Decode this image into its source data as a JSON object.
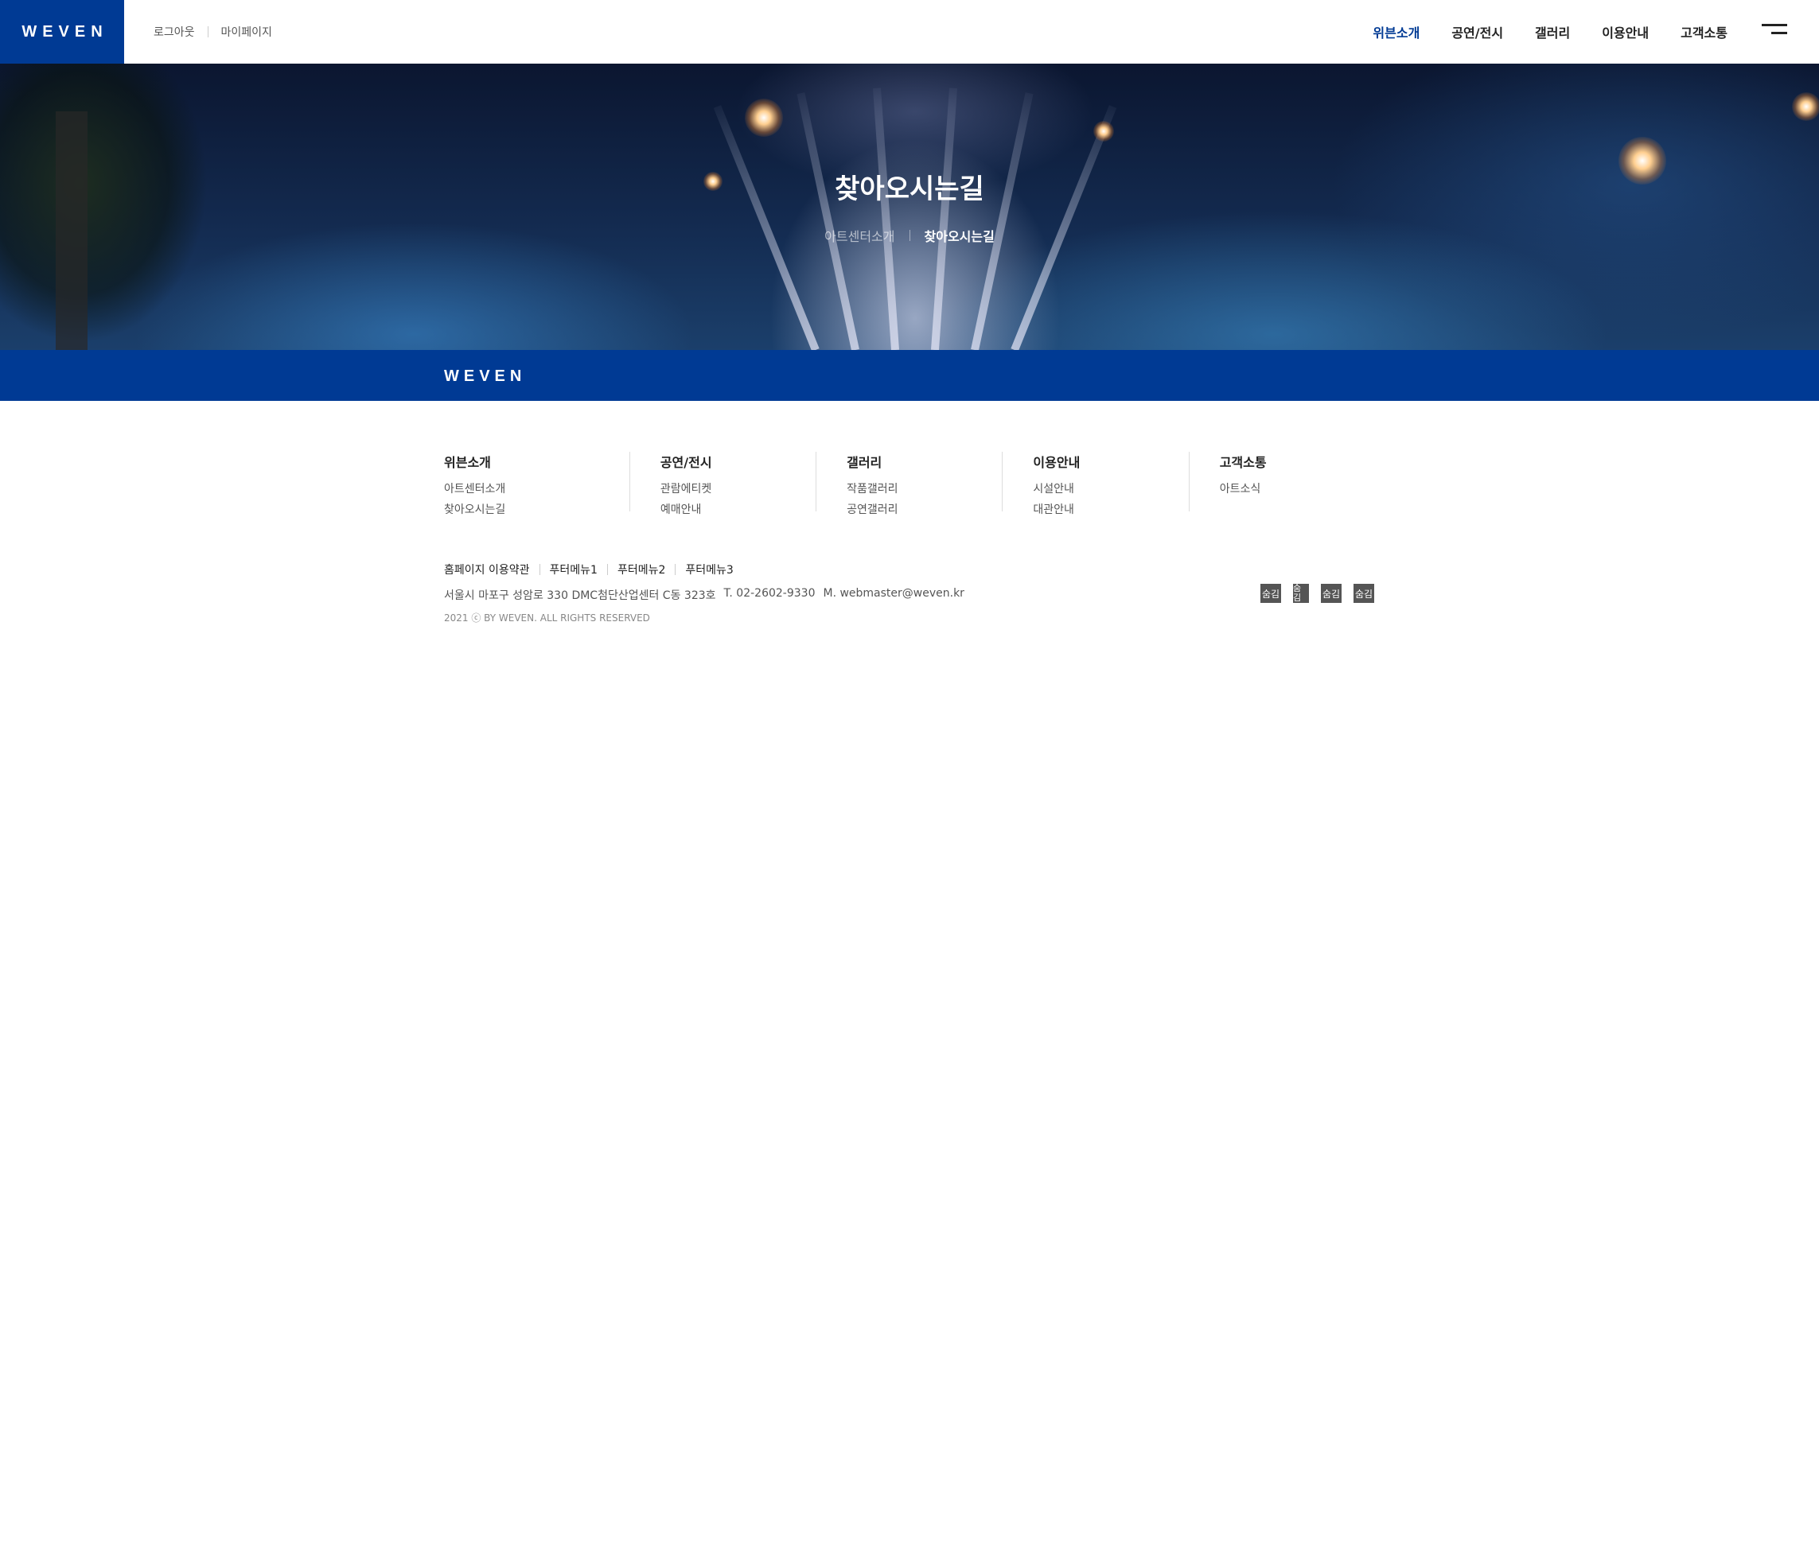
{
  "header": {
    "logo": "WEVEN",
    "util_links": [
      "로그아웃",
      "마이페이지"
    ],
    "nav": [
      {
        "label": "위븐소개",
        "active": true
      },
      {
        "label": "공연/전시",
        "active": false
      },
      {
        "label": "갤러리",
        "active": false
      },
      {
        "label": "이용안내",
        "active": false
      },
      {
        "label": "고객소통",
        "active": false
      }
    ],
    "menu_icon": "hamburger-menu-icon"
  },
  "hero": {
    "title": "찾아오시는길",
    "breadcrumb": [
      "아트센터소개",
      "찾아오시는길"
    ]
  },
  "band": {
    "logo": "WEVEN"
  },
  "sitemap": [
    {
      "title": "위븐소개",
      "items": [
        "아트센터소개",
        "찾아오시는길"
      ]
    },
    {
      "title": "공연/전시",
      "items": [
        "관람에티켓",
        "예매안내"
      ]
    },
    {
      "title": "갤러리",
      "items": [
        "작품갤러리",
        "공연갤러리"
      ]
    },
    {
      "title": "이용안내",
      "items": [
        "시설안내",
        "대관안내"
      ]
    },
    {
      "title": "고객소통",
      "items": [
        "아트소식"
      ]
    }
  ],
  "footer": {
    "links": [
      "홈페이지 이용약관",
      "푸터메뉴1",
      "푸터메뉴2",
      "푸터메뉴3"
    ],
    "address": "서울시 마포구 성암로 330 DMC첨단산업센터 C동 323호",
    "tel": "T. 02-2602-9330",
    "mail": "M. webmaster@weven.kr",
    "copyright": "2021 ⓒ BY WEVEN. ALL RIGHTS RESERVED",
    "icons": [
      "숨김",
      "숨김",
      "숨김",
      "숨김"
    ]
  },
  "colors": {
    "brand": "#003a94",
    "active_nav": "#003a94"
  }
}
